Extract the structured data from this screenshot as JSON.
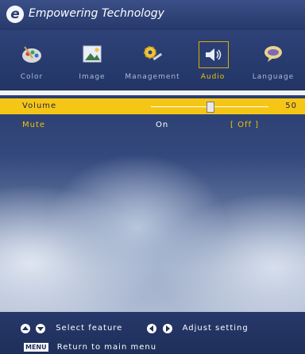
{
  "header": {
    "title": "Empowering Technology",
    "logo_letter": "e"
  },
  "tabs": [
    {
      "label": "Color",
      "icon": "color-palette-icon",
      "active": false
    },
    {
      "label": "Image",
      "icon": "image-picture-icon",
      "active": false
    },
    {
      "label": "Management",
      "icon": "gear-tools-icon",
      "active": false
    },
    {
      "label": "Audio",
      "icon": "speaker-icon",
      "active": true
    },
    {
      "label": "Language",
      "icon": "speech-bubble-icon",
      "active": false
    }
  ],
  "settings": {
    "volume": {
      "label": "Volume",
      "value": "50",
      "level_percent": 50
    },
    "mute": {
      "label": "Mute",
      "option_on": "On",
      "option_off": "[ Off ]",
      "selected": "Off"
    }
  },
  "help": {
    "select_text": "Select feature",
    "adjust_text": "Adjust setting",
    "menu_key": "MENU",
    "return_text": "Return to main menu"
  },
  "colors": {
    "accent": "#f6c617",
    "header": "#2e4279",
    "highlight_text": "#f2c200"
  }
}
